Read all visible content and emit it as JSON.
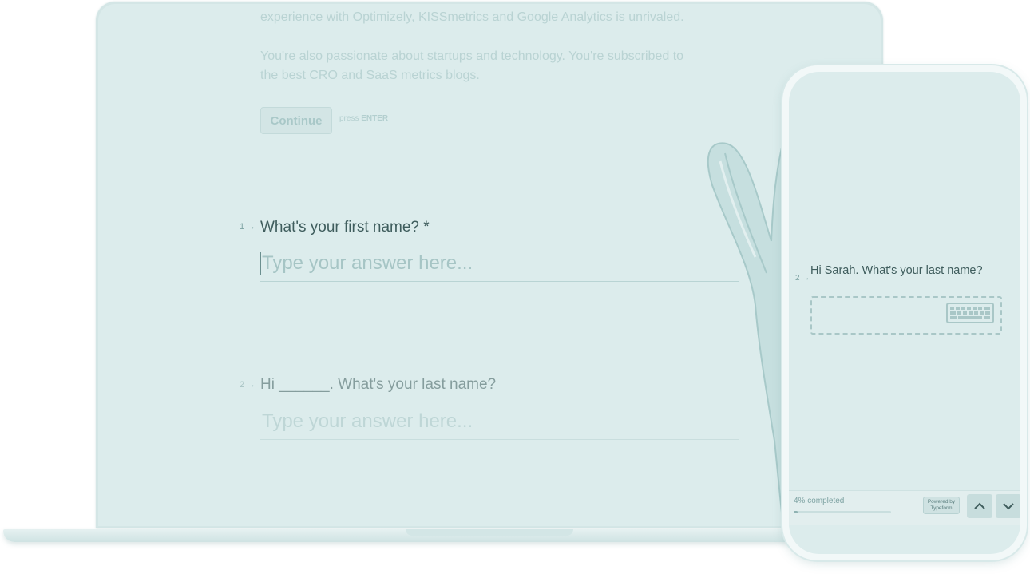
{
  "laptop": {
    "intro_line_1": "experience with Optimizely, KISSmetrics and Google Analytics is unrivaled.",
    "intro_para_line_1": "You're also passionate about startups and technology. You're subscribed to",
    "intro_para_line_2": "the best CRO and SaaS metrics blogs.",
    "continue_label": "Continue",
    "press_label": "press",
    "enter_label": "ENTER",
    "question_1": {
      "number": "1 →",
      "title": "What's your first name? *",
      "placeholder": "Type your answer here..."
    },
    "question_2": {
      "number": "2 →",
      "title": "Hi ______. What's your last name?",
      "placeholder": "Type your answer here..."
    }
  },
  "phone": {
    "question": {
      "number": "2 →",
      "title": "Hi Sarah. What's your last name?"
    },
    "input_icon": "keyboard-icon",
    "progress_text": "4% completed",
    "progress_fraction": 0.04,
    "powered_line_1": "Powered by",
    "powered_line_2": "Typeform",
    "nav_up_icon": "chevron-up-icon",
    "nav_down_icon": "chevron-down-icon"
  },
  "colors": {
    "background": "#dcecec",
    "text_dark": "#3f5d5d",
    "text_faded": "#b9d3d3"
  }
}
